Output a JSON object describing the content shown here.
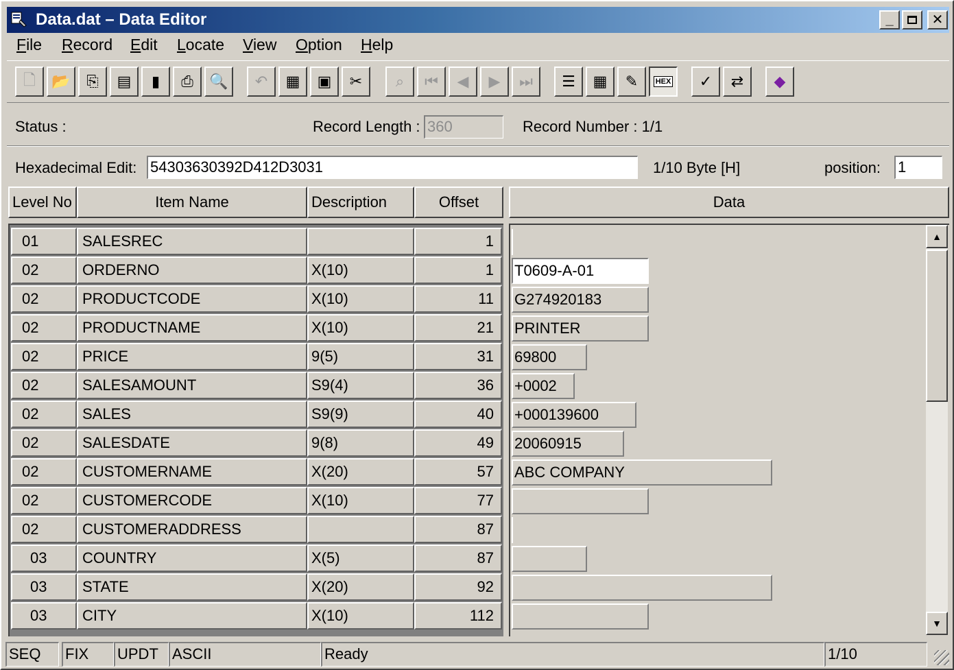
{
  "window": {
    "title": "Data.dat  –  Data Editor"
  },
  "menu": [
    "File",
    "Record",
    "Edit",
    "Locate",
    "View",
    "Option",
    "Help"
  ],
  "menu_mnemonics": [
    "F",
    "R",
    "E",
    "L",
    "V",
    "O",
    "H"
  ],
  "status_row": {
    "status_label": "Status :",
    "record_length_label": "Record Length :",
    "record_length_value": "360",
    "record_number_label": "Record Number : 1/1"
  },
  "hex_row": {
    "hex_label": "Hexadecimal Edit:",
    "hex_value": "54303630392D412D3031",
    "byte_info": "1/10 Byte [H]",
    "position_label": "position:",
    "position_value": "1"
  },
  "columns": {
    "level": "Level No",
    "name": "Item Name",
    "description": "Description",
    "offset": "Offset",
    "data": "Data"
  },
  "rows": [
    {
      "level": "01",
      "name": "SALESREC",
      "description": "",
      "offset": "1",
      "data": ""
    },
    {
      "level": "02",
      "name": "ORDERNO",
      "description": "X(10)",
      "offset": "1",
      "data": "T0609-A-01"
    },
    {
      "level": "02",
      "name": "PRODUCTCODE",
      "description": "X(10)",
      "offset": "11",
      "data": "G274920183"
    },
    {
      "level": "02",
      "name": "PRODUCTNAME",
      "description": "X(10)",
      "offset": "21",
      "data": "PRINTER"
    },
    {
      "level": "02",
      "name": "PRICE",
      "description": "9(5)",
      "offset": "31",
      "data": "69800"
    },
    {
      "level": "02",
      "name": "SALESAMOUNT",
      "description": "S9(4)",
      "offset": "36",
      "data": "+0002"
    },
    {
      "level": "02",
      "name": "SALES",
      "description": "S9(9)",
      "offset": "40",
      "data": "+000139600"
    },
    {
      "level": "02",
      "name": "SALESDATE",
      "description": "9(8)",
      "offset": "49",
      "data": "20060915"
    },
    {
      "level": "02",
      "name": "CUSTOMERNAME",
      "description": "X(20)",
      "offset": "57",
      "data": "ABC COMPANY"
    },
    {
      "level": "02",
      "name": "CUSTOMERCODE",
      "description": "X(10)",
      "offset": "77",
      "data": ""
    },
    {
      "level": "02",
      "name": "CUSTOMERADDRESS",
      "description": "",
      "offset": "87",
      "data": ""
    },
    {
      "level": "03",
      "name": "COUNTRY",
      "description": "X(5)",
      "offset": "87",
      "data": ""
    },
    {
      "level": "03",
      "name": "STATE",
      "description": "X(20)",
      "offset": "92",
      "data": ""
    },
    {
      "level": "03",
      "name": "CITY",
      "description": "X(10)",
      "offset": "112",
      "data": ""
    }
  ],
  "statusbar": {
    "mode1": "SEQ",
    "mode2": "FIX",
    "mode3": "UPDT",
    "mode4": "ASCII",
    "message": "Ready",
    "position": "1/10"
  },
  "toolbar_icons": [
    "new-icon",
    "open-icon",
    "import-icon",
    "save-icon",
    "save-as-icon",
    "print-icon",
    "print-preview-icon",
    "undo-icon",
    "insert-record-icon",
    "copy-record-icon",
    "cut-record-icon",
    "find-icon",
    "first-record-icon",
    "prev-record-icon",
    "next-record-icon",
    "last-record-icon",
    "list-view-icon",
    "table-view-icon",
    "edit-view-icon",
    "hex-view-icon",
    "check-icon",
    "convert-icon",
    "help-book-icon"
  ],
  "colors": {
    "titlebar_start": "#0a246a",
    "titlebar_end": "#a6caf0",
    "face": "#d4d0c8"
  }
}
